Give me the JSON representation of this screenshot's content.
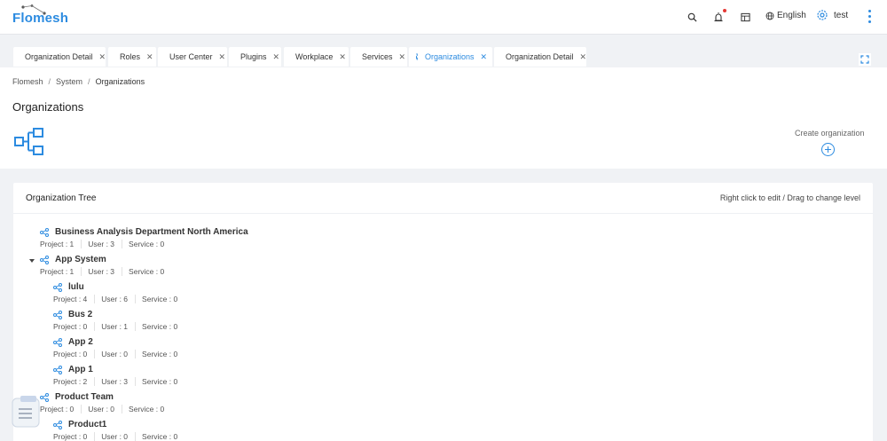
{
  "app": {
    "logo": "Flomesh",
    "language": "English",
    "user": "test"
  },
  "tabs": [
    {
      "label": "Organization Detail",
      "active": false
    },
    {
      "label": "Roles",
      "active": false
    },
    {
      "label": "User Center",
      "active": false
    },
    {
      "label": "Plugins",
      "active": false
    },
    {
      "label": "Workplace",
      "active": false
    },
    {
      "label": "Services",
      "active": false
    },
    {
      "label": "Organizations",
      "active": true
    },
    {
      "label": "Organization Detail",
      "active": false
    }
  ],
  "breadcrumb": [
    "Flomesh",
    "System",
    "Organizations"
  ],
  "page": {
    "title": "Organizations",
    "create_label": "Create organization"
  },
  "tree": {
    "title": "Organization Tree",
    "hint": "Right click to edit / Drag to change level",
    "nodes": [
      {
        "name": "Business Analysis Department North America",
        "project": "Project : 1",
        "user": "User : 3",
        "service": "Service : 0"
      },
      {
        "name": "App System",
        "project": "Project : 1",
        "user": "User : 3",
        "service": "Service : 0"
      },
      {
        "name": "lulu",
        "project": "Project : 4",
        "user": "User : 6",
        "service": "Service : 0"
      },
      {
        "name": "Bus 2",
        "project": "Project : 0",
        "user": "User : 1",
        "service": "Service : 0"
      },
      {
        "name": "App 2",
        "project": "Project : 0",
        "user": "User : 0",
        "service": "Service : 0"
      },
      {
        "name": "App 1",
        "project": "Project : 2",
        "user": "User : 3",
        "service": "Service : 0"
      },
      {
        "name": "Product Team",
        "project": "Project : 0",
        "user": "User : 0",
        "service": "Service : 0"
      },
      {
        "name": "Product1",
        "project": "Project : 0",
        "user": "User : 0",
        "service": "Service : 0"
      }
    ]
  },
  "colors": {
    "accent": "#2c8be0",
    "badge": "#e53935"
  }
}
